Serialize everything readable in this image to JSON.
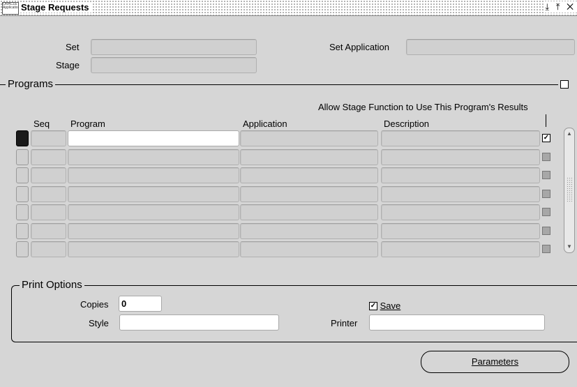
{
  "window": {
    "title": "Stage Requests",
    "icon_text": "ORACLE Applications",
    "controls": "⤓ ⤒ ✕"
  },
  "header": {
    "set_label": "Set",
    "set_value": "",
    "set_application_label": "Set Application",
    "set_application_value": "",
    "stage_label": "Stage",
    "stage_value": ""
  },
  "programs": {
    "section_title": "Programs",
    "allow_label": "Allow Stage Function to Use This Program's Results",
    "columns": {
      "seq": "Seq",
      "program": "Program",
      "application": "Application",
      "description": "Description"
    },
    "rows": [
      {
        "seq": "",
        "program": "",
        "application": "",
        "description": "",
        "allow": true,
        "active": true
      },
      {
        "seq": "",
        "program": "",
        "application": "",
        "description": "",
        "allow": false,
        "active": false
      },
      {
        "seq": "",
        "program": "",
        "application": "",
        "description": "",
        "allow": false,
        "active": false
      },
      {
        "seq": "",
        "program": "",
        "application": "",
        "description": "",
        "allow": false,
        "active": false
      },
      {
        "seq": "",
        "program": "",
        "application": "",
        "description": "",
        "allow": false,
        "active": false
      },
      {
        "seq": "",
        "program": "",
        "application": "",
        "description": "",
        "allow": false,
        "active": false
      },
      {
        "seq": "",
        "program": "",
        "application": "",
        "description": "",
        "allow": false,
        "active": false
      }
    ]
  },
  "print_options": {
    "section_title": "Print Options",
    "copies_label": "Copies",
    "copies_value": "0",
    "save_label": "Save",
    "save_checked": true,
    "style_label": "Style",
    "style_value": "",
    "printer_label": "Printer",
    "printer_value": ""
  },
  "actions": {
    "parameters_label": "Parameters"
  }
}
